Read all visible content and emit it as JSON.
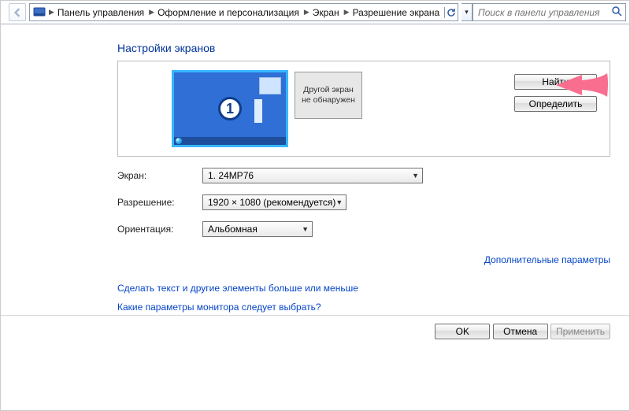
{
  "breadcrumb": {
    "items": [
      "Панель управления",
      "Оформление и персонализация",
      "Экран",
      "Разрешение экрана"
    ]
  },
  "search": {
    "placeholder": "Поиск в панели управления"
  },
  "section_title": "Настройки экранов",
  "preview": {
    "monitor1_number": "1",
    "monitor2_line1": "Другой экран",
    "monitor2_line2": "не обнаружен",
    "find_btn": "Найти",
    "identify_btn": "Определить"
  },
  "fields": {
    "screen_label": "Экран:",
    "screen_value": "1. 24MP76",
    "resolution_label": "Разрешение:",
    "resolution_value": "1920 × 1080 (рекомендуется)",
    "orientation_label": "Ориентация:",
    "orientation_value": "Альбомная"
  },
  "links": {
    "advanced": "Дополнительные параметры",
    "text_size": "Сделать текст и другие элементы больше или меньше",
    "which_monitor": "Какие параметры монитора следует выбрать?"
  },
  "footer": {
    "ok": "OK",
    "cancel": "Отмена",
    "apply": "Применить"
  },
  "annotation_color": "#f96e8f"
}
